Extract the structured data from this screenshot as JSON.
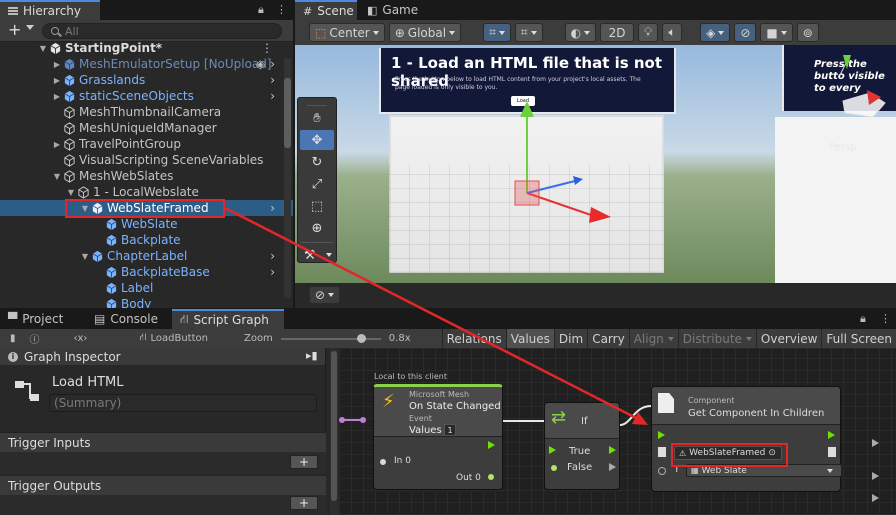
{
  "hierarchy": {
    "tab": "Hierarchy",
    "search_placeholder": "All",
    "scene_name": "StartingPoint*",
    "items": [
      {
        "label": "MeshEmulatorSetup [NoUpload]"
      },
      {
        "label": "Grasslands"
      },
      {
        "label": "staticSceneObjects"
      },
      {
        "label": "MeshThumbnailCamera"
      },
      {
        "label": "MeshUniqueIdManager"
      },
      {
        "label": "TravelPointGroup"
      },
      {
        "label": "VisualScripting SceneVariables"
      },
      {
        "label": "MeshWebSlates"
      },
      {
        "label": "1 - LocalWebslate"
      },
      {
        "label": "WebSlateFramed"
      },
      {
        "label": "WebSlate"
      },
      {
        "label": "Backplate"
      },
      {
        "label": "ChapterLabel"
      },
      {
        "label": "BackplateBase"
      },
      {
        "label": "Label"
      },
      {
        "label": "Body"
      }
    ]
  },
  "scene": {
    "tabs": [
      "Scene",
      "Game"
    ],
    "pivot": "Center",
    "space": "Global",
    "mode_2d": "2D",
    "persp_label": "Persp",
    "panel_title": "1 - Load an HTML file that is not shared",
    "panel_body": "Press the button below to load HTML content from your project's local assets. The page loaded is only visible to you.",
    "panel_button": "Load",
    "right_panel_text": "Press the butto visible to every"
  },
  "graph": {
    "tabs": [
      "Project",
      "Console",
      "Script Graph"
    ],
    "breadcrumb": "LoadButton",
    "zoom_label": "Zoom",
    "zoom_value": "0.8x",
    "toolbar_buttons": [
      "Relations",
      "Values",
      "Dim",
      "Carry",
      "Align",
      "Distribute",
      "Overview",
      "Full Screen"
    ],
    "inspector": {
      "header": "Graph Inspector",
      "title": "Load HTML",
      "summary_placeholder": "(Summary)",
      "trigger_inputs": "Trigger Inputs",
      "trigger_outputs": "Trigger Outputs"
    },
    "nodes": {
      "state": {
        "group_label": "Local to this client",
        "category": "Microsoft Mesh",
        "title": "On State Changed",
        "subtitle": "Event",
        "values_label": "Values",
        "values_count": "1",
        "in_label": "In 0",
        "out_label": "Out 0"
      },
      "if": {
        "title": "If",
        "true_label": "True",
        "false_label": "False"
      },
      "component": {
        "category": "Component",
        "title": "Get Component In Children",
        "target_value": "WebSlateFramed",
        "type_value": "Web Slate",
        "type_prefix": "T"
      }
    }
  }
}
